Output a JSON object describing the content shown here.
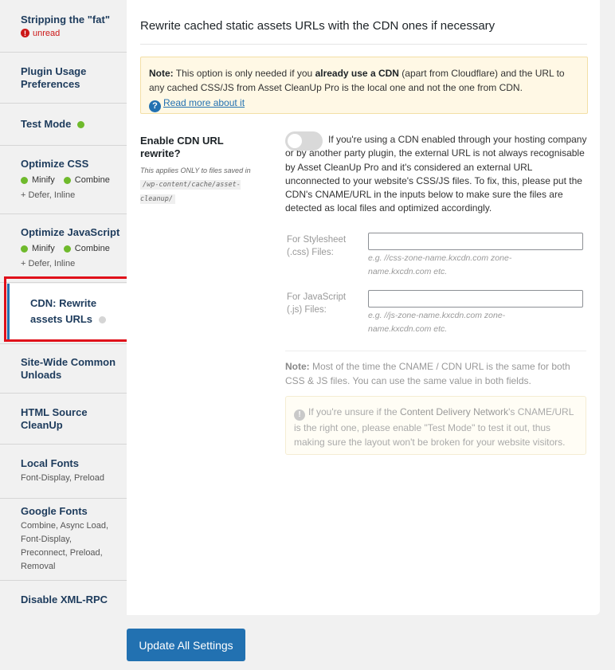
{
  "sidebar": {
    "items": [
      {
        "title": "Stripping the \"fat\"",
        "badge": "unread"
      },
      {
        "title": "Plugin Usage Preferences"
      },
      {
        "title": "Test Mode",
        "status": "green"
      },
      {
        "title": "Optimize CSS",
        "features": [
          "Minify",
          "Combine"
        ],
        "sub": "+ Defer, Inline"
      },
      {
        "title": "Optimize JavaScript",
        "features": [
          "Minify",
          "Combine"
        ],
        "sub": "+ Defer, Inline"
      },
      {
        "title": "CDN: Rewrite assets URLs",
        "status": "grey",
        "active": true
      },
      {
        "title": "Site-Wide Common Unloads"
      },
      {
        "title": "HTML Source CleanUp"
      },
      {
        "title": "Local Fonts",
        "sub": "Font-Display, Preload"
      },
      {
        "title": "Google Fonts",
        "sub": "Combine, Async Load, Font-Display, Preconnect, Preload, Removal"
      },
      {
        "title": "Disable XML-RPC"
      }
    ]
  },
  "main": {
    "title": "Rewrite cached static assets URLs with the CDN ones if necessary",
    "note": {
      "label": "Note:",
      "text1": " This option is only needed if you ",
      "bold": "already use a CDN",
      "text2": " (apart from Cloudflare) and the URL to any cached CSS/JS from Asset CleanUp Pro is the local one and not the one from CDN.",
      "link": "Read more about it"
    },
    "cdn_setting": {
      "label": "Enable CDN URL rewrite?",
      "sub_prefix": "This applies ONLY to files saved in",
      "sub_code": "/wp-content/cache/asset-cleanup/",
      "enabled": false,
      "description": "If you're using a CDN enabled through your hosting company or by another party plugin, the external URL is not always recognisable by Asset CleanUp Pro and it's considered an external URL unconnected to your website's CSS/JS files. To fix, this, please put the CDN's CNAME/URL in the inputs below to make sure the files are detected as local files and optimized accordingly."
    },
    "fields": {
      "css_label": "For Stylesheet (.css) Files:",
      "css_value": "",
      "css_hint": "e.g. //css-zone-name.kxcdn.com zone-name.kxcdn.com etc.",
      "js_label": "For JavaScript (.js) Files:",
      "js_value": "",
      "js_hint": "e.g. //js-zone-name.kxcdn.com zone-name.kxcdn.com etc."
    },
    "note2": {
      "label": "Note:",
      "text": " Most of the time the CNAME / CDN URL is the same for both CSS & JS files. You can use the same value in both fields."
    },
    "info": {
      "text1": "If you're unsure if the ",
      "bold": "Content Delivery Network",
      "text2": "'s CNAME/URL is the right one, please enable \"Test Mode\" to test it out, thus making sure the layout won't be broken for your website visitors."
    }
  },
  "footer": {
    "update_label": "Update All Settings"
  },
  "colors": {
    "accent": "#2271b1",
    "green": "#6fba2c",
    "highlight": "#e0101a"
  }
}
